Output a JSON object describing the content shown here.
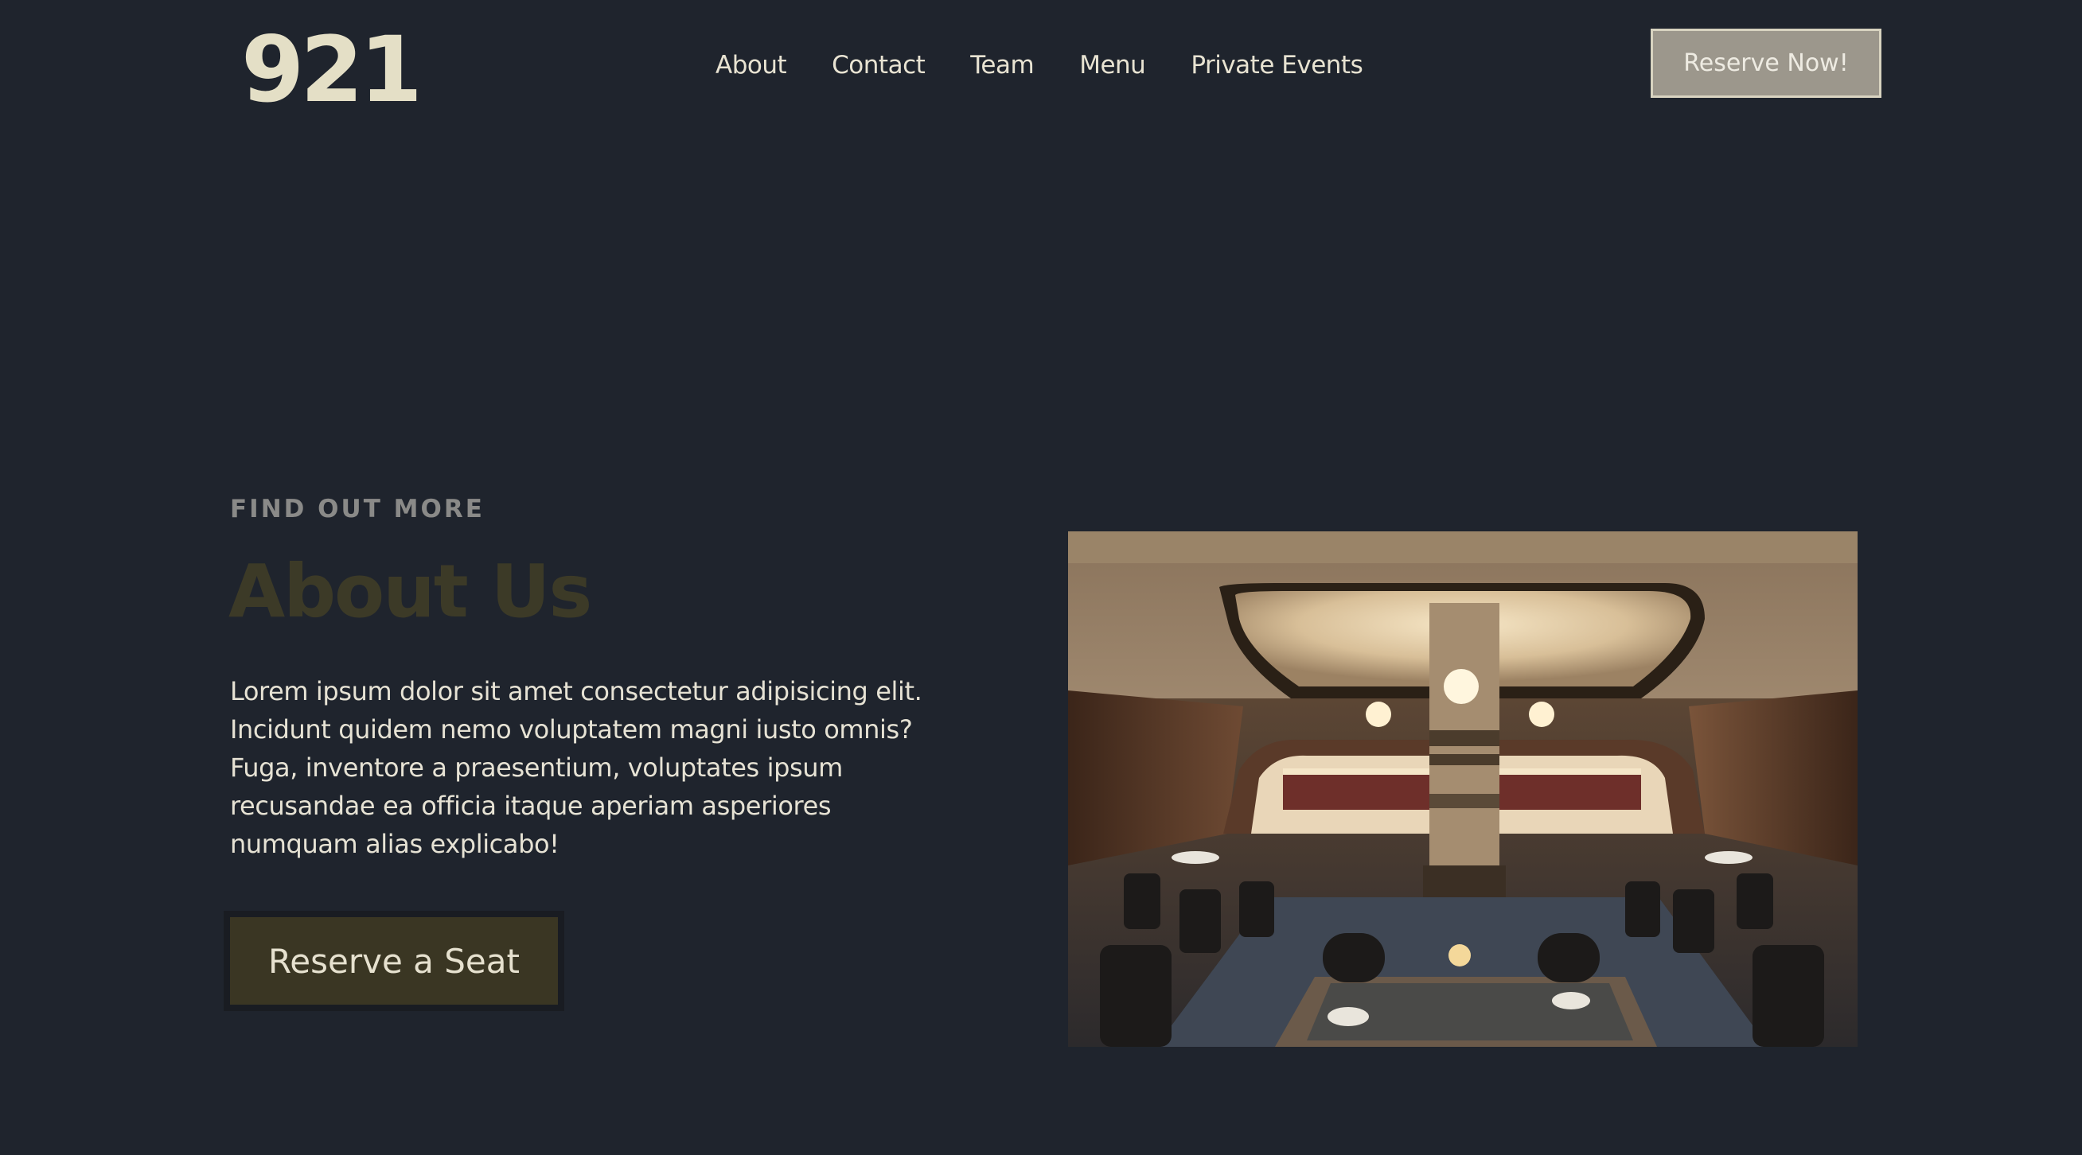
{
  "brand": {
    "logo_text": "921"
  },
  "nav": {
    "items": [
      {
        "label": "About"
      },
      {
        "label": "Contact"
      },
      {
        "label": "Team"
      },
      {
        "label": "Menu"
      },
      {
        "label": "Private Events"
      }
    ]
  },
  "header": {
    "cta_label": "Reserve Now!"
  },
  "about": {
    "eyebrow": "FIND OUT MORE",
    "title": "About Us",
    "body": "Lorem ipsum dolor sit amet consectetur adipisicing elit. Incidunt quidem nemo voluptatem magni iusto omnis? Fuga, inventore a praesentium, voluptates ipsum recusandae ea officia itaque aperiam asperiores numquam alias explicabo!",
    "cta_label": "Reserve a Seat"
  },
  "colors": {
    "background": "#1f242d",
    "logo": "#e4dfc6",
    "header_button": "#9c978c",
    "title": "#3c3a27",
    "seat_button": "#3a3623"
  }
}
